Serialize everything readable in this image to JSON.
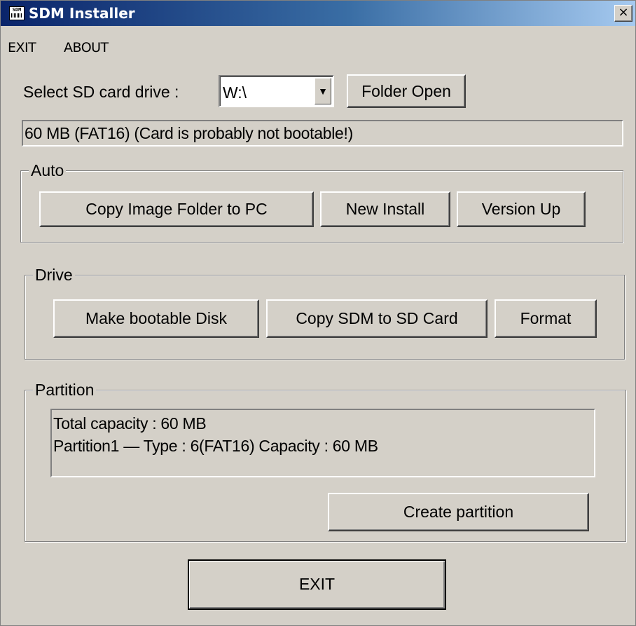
{
  "window": {
    "title": "SDM Installer",
    "close_glyph": "×",
    "icon": "sdm-app-icon",
    "icon_text": "SDM"
  },
  "menu": {
    "items": [
      "EXIT",
      "ABOUT"
    ]
  },
  "drive_select": {
    "label": "Select SD card drive :",
    "value": "W:\\",
    "folder_open": "Folder Open"
  },
  "status": {
    "text": "60 MB (FAT16) (Card is probably not bootable!)"
  },
  "auto": {
    "title": "Auto",
    "copy_image": "Copy Image Folder to PC",
    "new_install": "New Install",
    "version_up": "Version Up"
  },
  "drive": {
    "title": "Drive",
    "make_bootable": "Make bootable Disk",
    "copy_sdm": "Copy SDM to SD Card",
    "format": "Format"
  },
  "partition": {
    "title": "Partition",
    "lines": [
      "Total capacity : 60 MB",
      "Partition1  —  Type : 6(FAT16)  Capacity : 60 MB"
    ],
    "create": "Create partition"
  },
  "footer": {
    "exit": "EXIT"
  },
  "colors": {
    "face": "#d4d0c8",
    "title_start": "#0a246a",
    "title_end": "#a6caf0"
  }
}
